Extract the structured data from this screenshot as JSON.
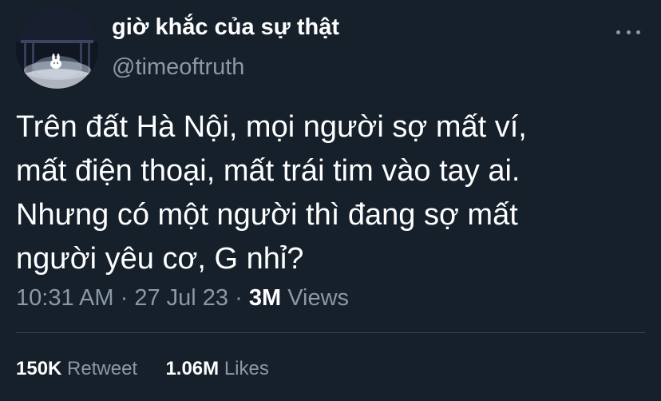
{
  "author": {
    "display_name": "giờ khắc của sự thật",
    "handle": "@timeoftruth",
    "avatar": "avatar-sleeping-bunny-icon"
  },
  "menu": {
    "icon": "more-horizontal-icon"
  },
  "tweet": {
    "lines": [
      "Trên đất Hà Nội, mọi người sợ mất ví,",
      "mất điện thoại, mất trái tim vào tay ai.",
      "Nhưng có một người thì đang sợ mất",
      "người yêu cơ, G nhỉ?"
    ]
  },
  "meta": {
    "time": "10:31 AM",
    "separator": "·",
    "date": "27 Jul 23",
    "views_count": "3M",
    "views_label": "Views"
  },
  "stats": {
    "retweets_count": "150K",
    "retweets_label": "Retweet",
    "likes_count": "1.06M",
    "likes_label": "Likes"
  },
  "colors": {
    "background": "#15202b",
    "primary_text": "#ffffff",
    "secondary_text": "#8b98a5",
    "divider": "#38444d"
  }
}
